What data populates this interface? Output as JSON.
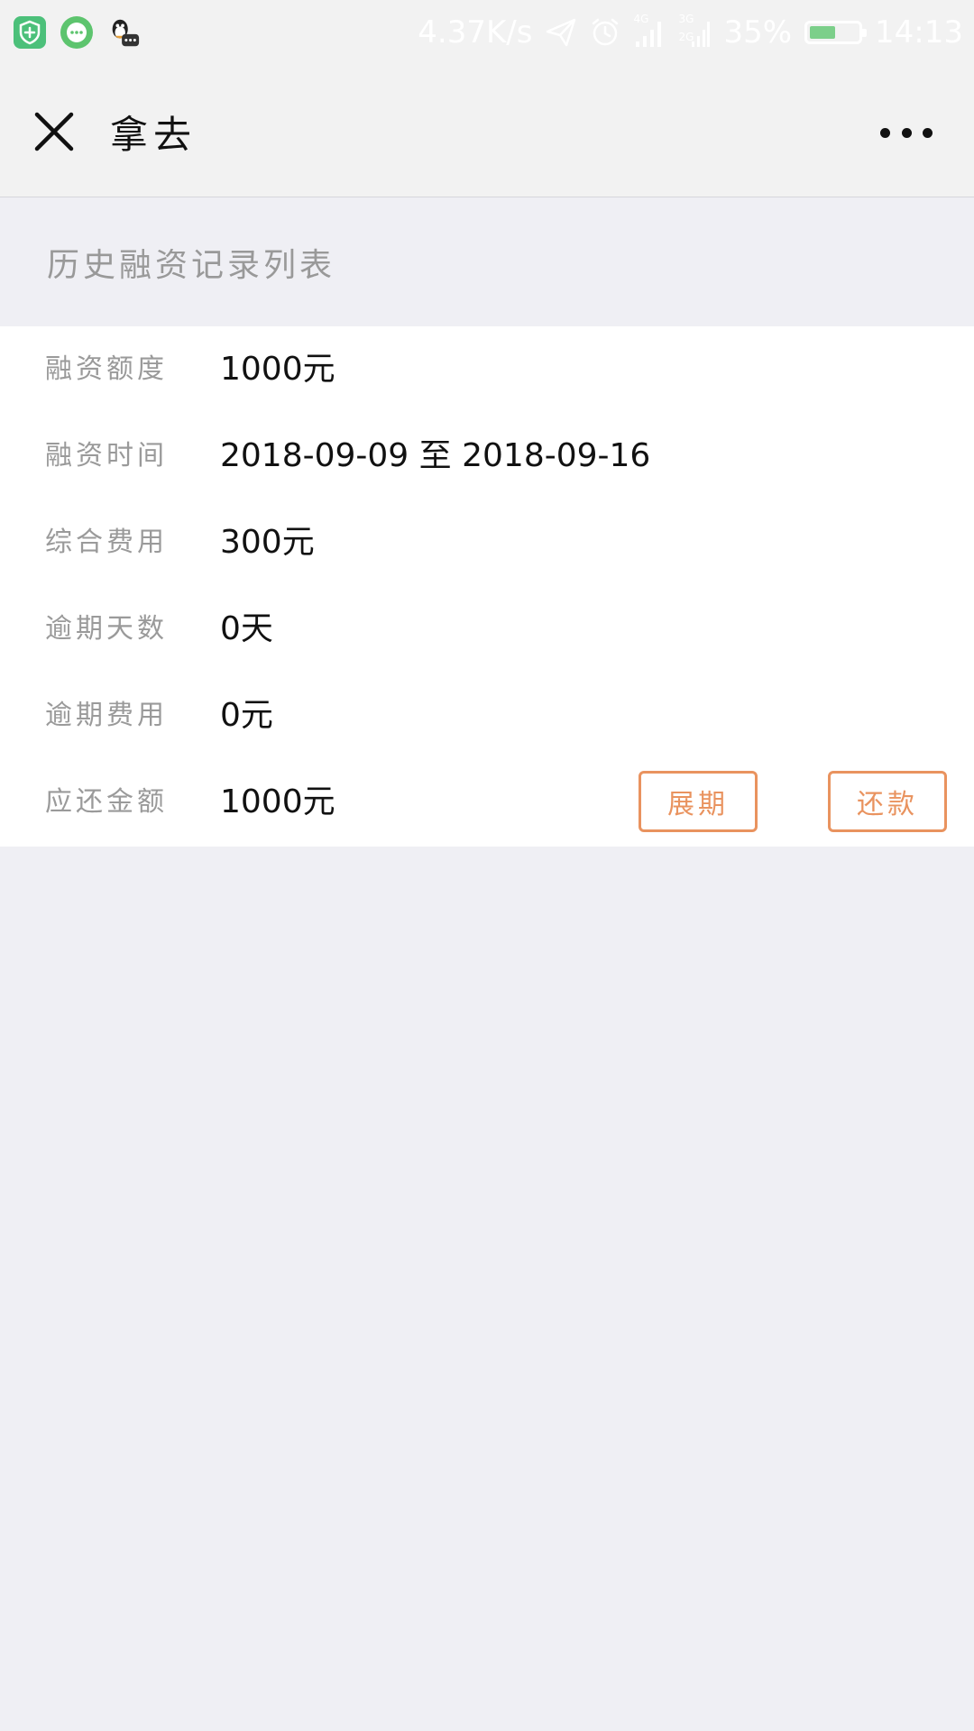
{
  "status_bar": {
    "network_speed": "4.37K/s",
    "sim1_label": "4G",
    "sim2_label": "3G",
    "sim2_sub_label": "2G",
    "battery_percent": "35%",
    "battery_level": 0.35,
    "time": "14:13",
    "apps": [
      {
        "icon": "shield-app-icon",
        "color": "#4cc07a"
      },
      {
        "icon": "message-app-icon",
        "color": "#5dc46e"
      },
      {
        "icon": "qq-penguin-icon",
        "color": "#222222"
      }
    ]
  },
  "nav": {
    "title": "拿去",
    "close_icon": "close-icon",
    "more_icon": "more-icon"
  },
  "section": {
    "title": "历史融资记录列表"
  },
  "record": {
    "rows": [
      {
        "label": "融资额度",
        "value": "1000元"
      },
      {
        "label": "融资时间",
        "value": "2018-09-09 至 2018-09-16"
      },
      {
        "label": "综合费用",
        "value": "300元"
      },
      {
        "label": "逾期天数",
        "value": "0天"
      },
      {
        "label": "逾期费用",
        "value": "0元"
      },
      {
        "label": "应还金额",
        "value": "1000元"
      }
    ],
    "extend_button": "展期",
    "repay_button": "还款"
  },
  "colors": {
    "accent": "#e9935f",
    "label": "#9a9a9a",
    "page_background": "#efeff4"
  }
}
